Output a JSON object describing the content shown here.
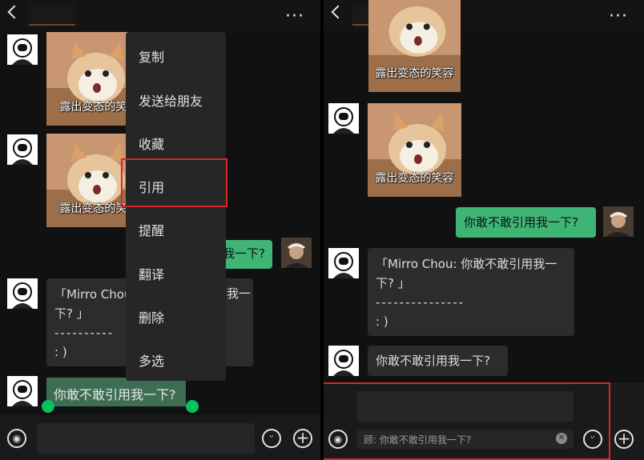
{
  "left": {
    "sticker_caption": "露出变态的笑",
    "green_partial": "我一下?",
    "quote_text_1": "「Mirro Chou",
    "quote_text_2": "下? 」",
    "quote_tail": "我一",
    "quote_dashes": "----------",
    "quote_end": ": )",
    "selected_message": "你敢不敢引用我一下?",
    "menu": [
      "复制",
      "发送给朋友",
      "收藏",
      "引用",
      "提醒",
      "翻译",
      "删除",
      "多选"
    ]
  },
  "right": {
    "sticker_caption": "露出变态的笑容",
    "green_message": "你敢不敢引用我一下?",
    "quote_line1": "「Mirro Chou: 你敢不敢引用我一",
    "quote_line2": "下? 」",
    "quote_dashes": "---------------",
    "quote_end": ": )",
    "last_message": "你敢不敢引用我一下?",
    "quote_field": "顾: 你敢不敢引用我一下?"
  },
  "icons": [
    "back-icon",
    "more-icon",
    "voice-icon",
    "emoji-icon",
    "plus-icon",
    "clear-icon"
  ],
  "colors": {
    "green": "#3eb575",
    "highlight": "#d8262b",
    "bubble": "#2c2c2c"
  }
}
